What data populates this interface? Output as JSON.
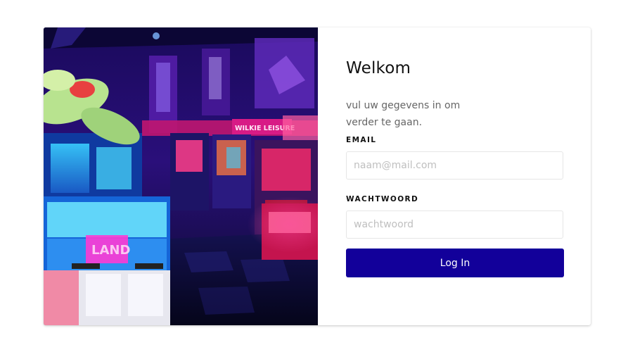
{
  "login": {
    "title": "Welkom",
    "subtitle": "vul uw gegevens in om verder te gaan.",
    "email_label": "EMAIL",
    "email_value": "",
    "email_placeholder": "naam@mail.com",
    "password_label": "WACHTWOORD",
    "password_value": "",
    "password_placeholder": "wachtwoord",
    "submit_label": "Log In"
  },
  "photo": {
    "sign_text": "WILKIE LEISURE"
  },
  "colors": {
    "button": "#12009a",
    "label": "#111111",
    "subtitle": "#666666",
    "input_border": "#e6e6e6"
  }
}
